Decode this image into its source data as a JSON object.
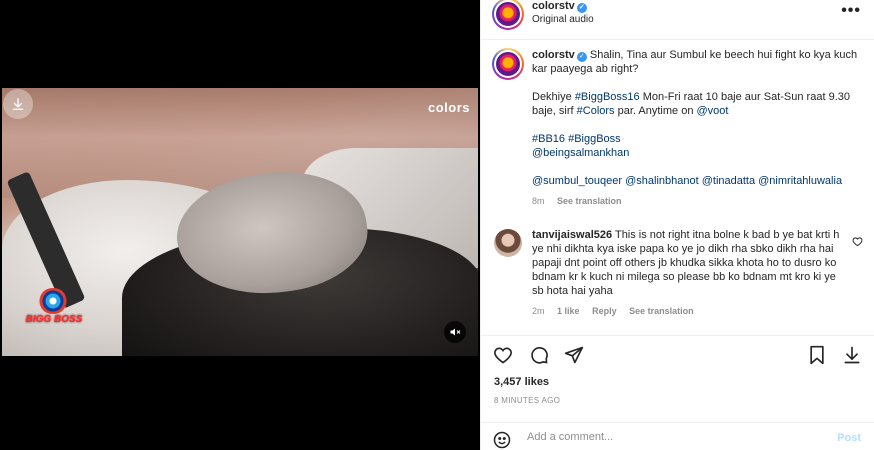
{
  "media": {
    "watermark": "colors",
    "brand_logo_text": "BIGG BOSS",
    "download_icon": "download-icon",
    "mute_icon": "speaker-muted-icon"
  },
  "header": {
    "username": "colorstv",
    "audio": "Original audio",
    "more_icon": "more-options-icon"
  },
  "caption": {
    "username": "colorstv",
    "text_1": "Shalin, Tina aur Sumbul ke beech hui fight ko kya kuch kar paayega ab right?",
    "text_2a": "Dekhiye",
    "tag_bb16": "#BiggBoss16",
    "text_2b": "Mon-Fri raat 10 baje aur Sat-Sun raat 9.30 baje, sirf",
    "tag_colors": "#Colors",
    "text_2c": "par. Anytime on",
    "mention_voot": "@voot",
    "tags_line": "#BB16 #BiggBoss",
    "mention_salman": "@beingsalmankhan",
    "mentions_line": "@sumbul_touqeer @shalinbhanot @tinadatta @nimritahluwalia",
    "time": "8m",
    "see_translation": "See translation"
  },
  "comment": {
    "username": "tanvijaiswal526",
    "text": "This is not right itna bolne k bad b ye bat krti h ye nhi dikhta kya iske papa ko ye jo dikh rha sbko dikh rha hai papaji dnt point off others jb khudka sikka khota ho to dusro ko bdnam kr k kuch ni milega so please bb ko bdnam mt kro ki ye sb hota hai yaha",
    "time": "2m",
    "likes": "1 like",
    "reply": "Reply",
    "see_translation": "See translation"
  },
  "stats": {
    "likes": "3,457 likes",
    "ago": "8 MINUTES AGO"
  },
  "add_comment": {
    "placeholder": "Add a comment...",
    "post_label": "Post"
  },
  "colors": {
    "link": "#00376b",
    "post_disabled": "#b2dffc",
    "verified": "#3897f0"
  }
}
